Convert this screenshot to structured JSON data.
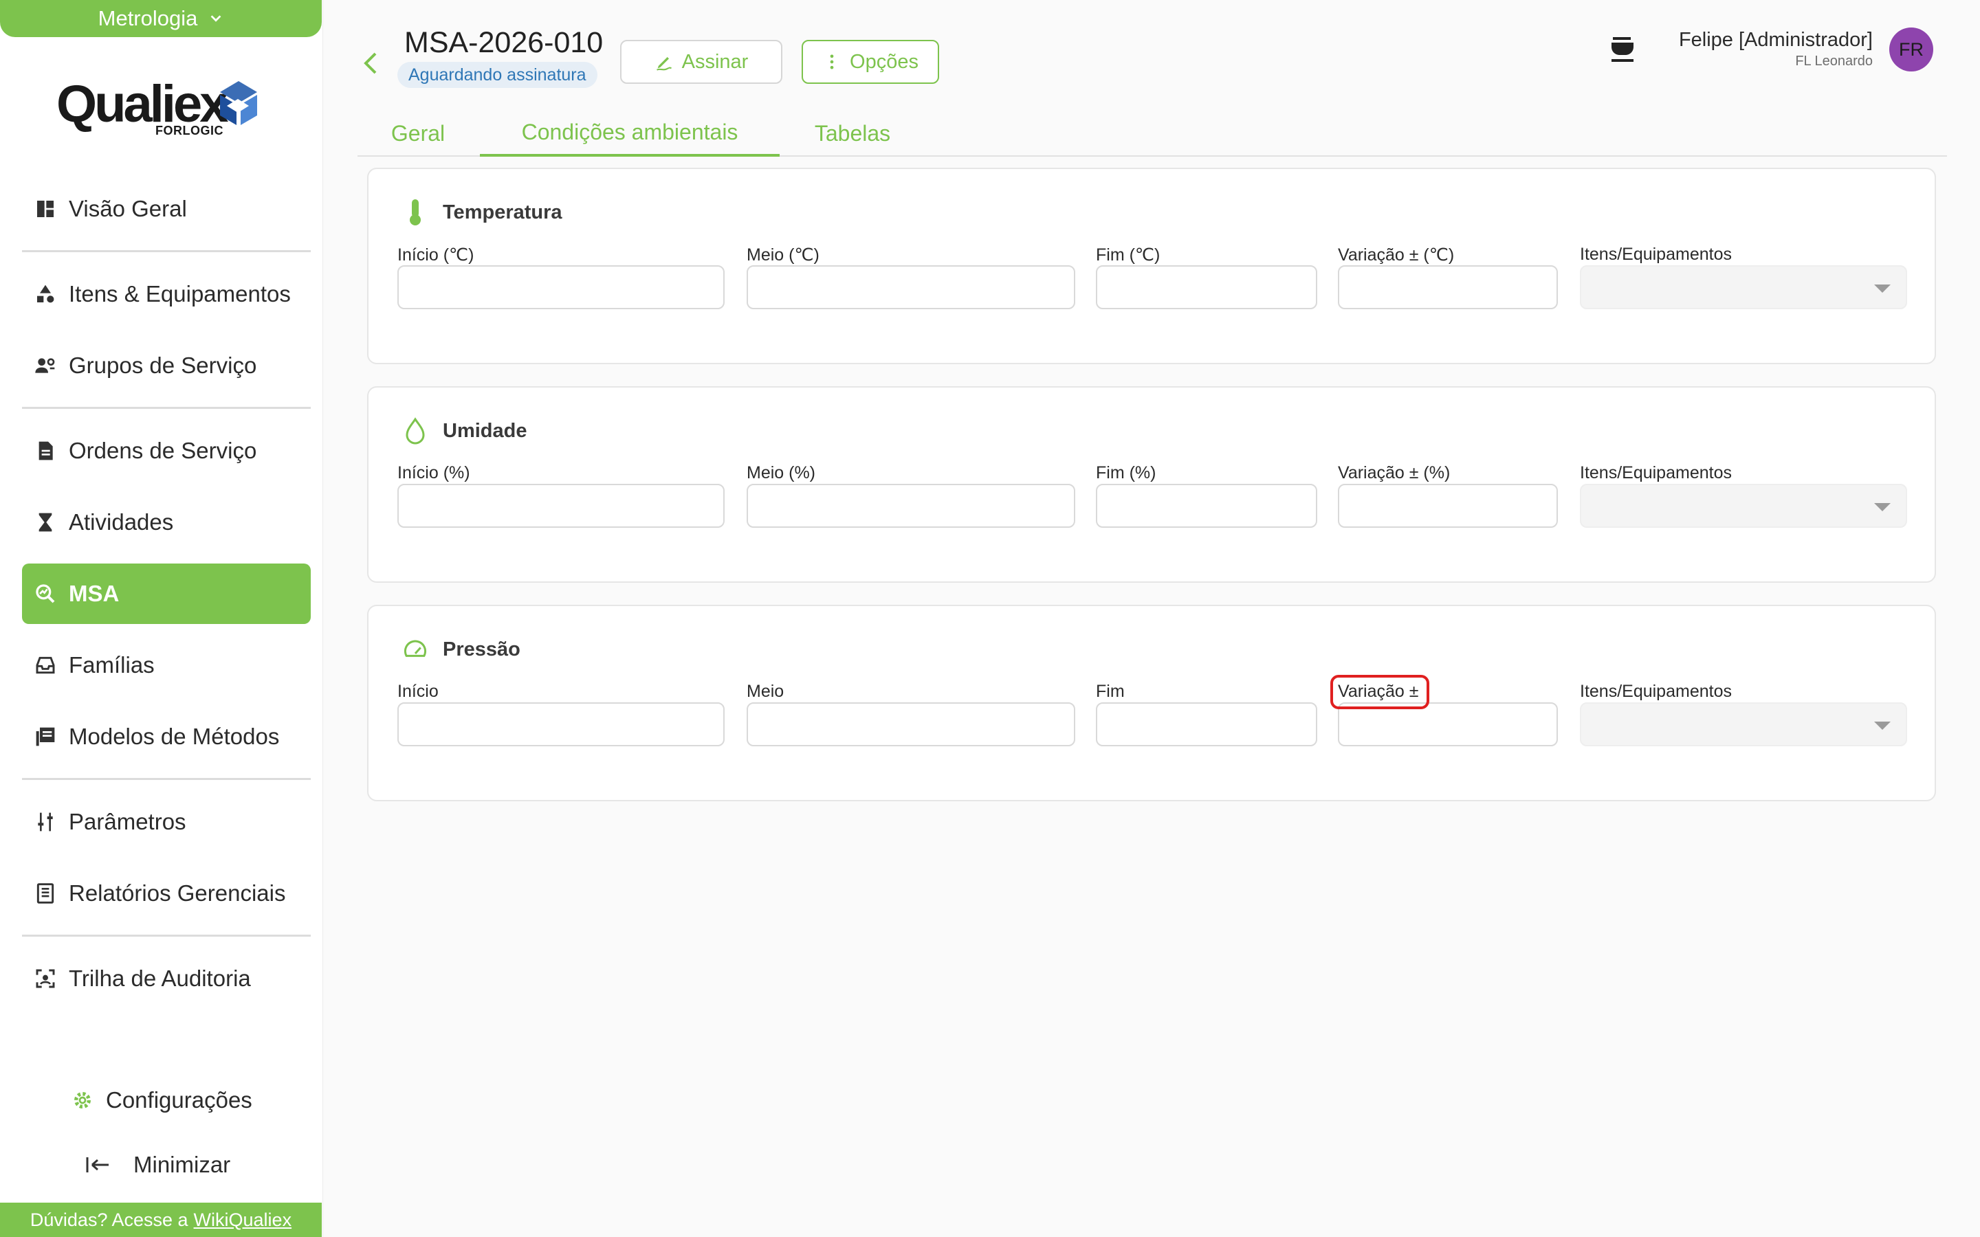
{
  "app": {
    "module": "Metrologia",
    "logo_word": "Qualiex",
    "logo_sub": "FORLOGIC"
  },
  "sidebar": {
    "items": [
      {
        "label": "Visão Geral",
        "icon": "dashboard-icon"
      },
      {
        "label": "Itens & Equipamentos",
        "icon": "shapes-icon"
      },
      {
        "label": "Grupos de Serviço",
        "icon": "group-settings-icon"
      },
      {
        "label": "Ordens de Serviço",
        "icon": "document-icon"
      },
      {
        "label": "Atividades",
        "icon": "hourglass-icon"
      },
      {
        "label": "MSA",
        "icon": "query-stats-icon"
      },
      {
        "label": "Famílias",
        "icon": "inbox-icon"
      },
      {
        "label": "Modelos de Métodos",
        "icon": "library-books-icon"
      },
      {
        "label": "Parâmetros",
        "icon": "sliders-icon"
      },
      {
        "label": "Relatórios Gerenciais",
        "icon": "report-icon"
      },
      {
        "label": "Trilha de Auditoria",
        "icon": "audit-scan-icon"
      }
    ],
    "active": "MSA",
    "config_label": "Configurações",
    "minimize_label": "Minimizar",
    "help_text": "Dúvidas? Acesse a",
    "help_link": "WikiQualiex"
  },
  "header": {
    "title": "MSA-2026-010",
    "status": "Aguardando assinatura",
    "sign_label": "Assinar",
    "options_label": "Opções",
    "user_name": "Felipe [Administrador]",
    "user_org": "FL Leonardo",
    "avatar_initials": "FR"
  },
  "tabs": [
    {
      "label": "Geral"
    },
    {
      "label": "Condições ambientais"
    },
    {
      "label": "Tabelas"
    }
  ],
  "active_tab": "Condições ambientais",
  "sections": {
    "temperature": {
      "title": "Temperatura",
      "labels": [
        "Início (℃)",
        "Meio (℃)",
        "Fim (℃)",
        "Variação ± (℃)",
        "Itens/Equipamentos"
      ]
    },
    "humidity": {
      "title": "Umidade",
      "labels": [
        "Início (%)",
        "Meio (%)",
        "Fim (%)",
        "Variação ± (%)",
        "Itens/Equipamentos"
      ]
    },
    "pressure": {
      "title": "Pressão",
      "labels": [
        "Início",
        "Meio",
        "Fim",
        "Variação ±",
        "Itens/Equipamentos"
      ]
    }
  },
  "colors": {
    "brand_green": "#7dc34d",
    "badge_blue": "#2f77b6",
    "avatar_purple": "#8e44ad",
    "highlight_red": "#e02020"
  }
}
